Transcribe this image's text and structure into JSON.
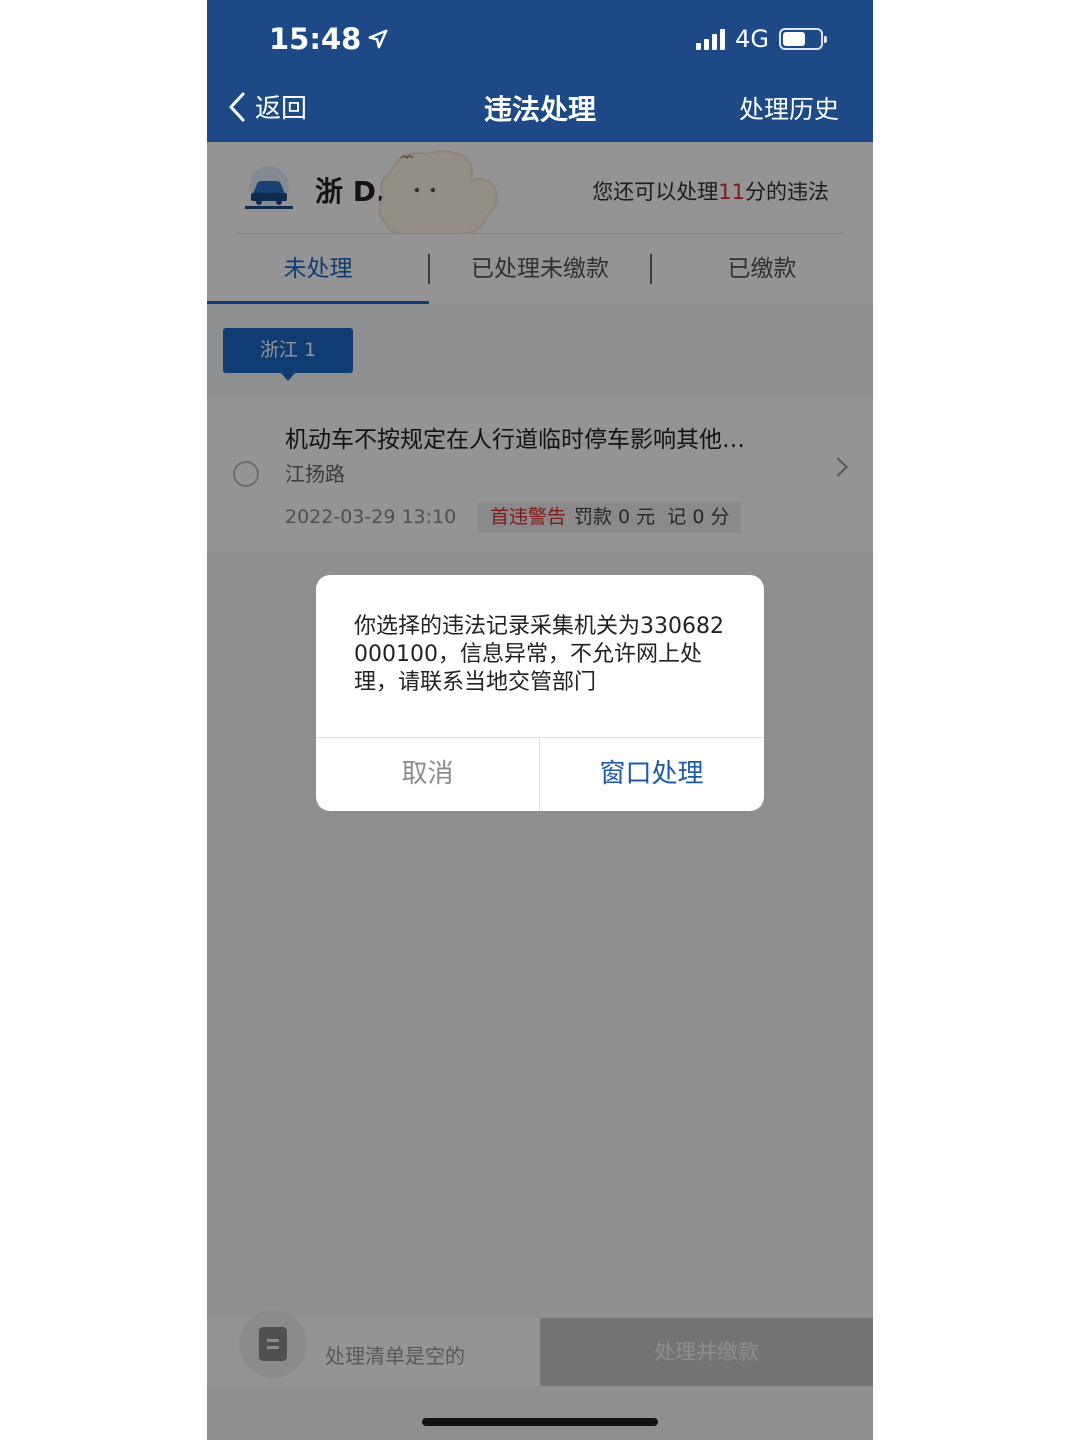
{
  "status_bar": {
    "time": "15:48",
    "network": "4G"
  },
  "nav": {
    "back_label": "返回",
    "title": "违法处理",
    "history_label": "处理历史"
  },
  "plate": {
    "text": "浙 D.",
    "remaining_prefix": "您还可以处理",
    "remaining_points": "11",
    "remaining_suffix": "分的违法"
  },
  "tabs": [
    {
      "label": "未处理",
      "active": true
    },
    {
      "label": "已处理未缴款",
      "active": false
    },
    {
      "label": "已缴款",
      "active": false
    }
  ],
  "region_chip": "浙江 1",
  "violation": {
    "title": "机动车不按规定在人行道临时停车影响其他…",
    "road": "江扬路",
    "datetime": "2022-03-29 13:10",
    "warning_tag": "首违警告",
    "fine_text": "罚款 0 元",
    "points_text": "记 0 分"
  },
  "bottom_bar": {
    "empty_text": "处理清单是空的",
    "pay_label": "处理并缴款"
  },
  "dialog": {
    "message": "你选择的违法记录采集机关为330682000100，信息异常，不允许网上处理，请联系当地交管部门",
    "cancel_label": "取消",
    "confirm_label": "窗口处理"
  },
  "colors": {
    "header_bg": "#1d4a87",
    "accent": "#1d68c9",
    "warning": "#d9302a"
  }
}
